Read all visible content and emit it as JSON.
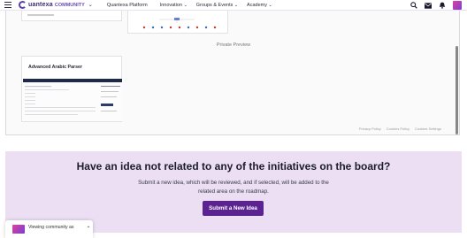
{
  "header": {
    "logo_text": "uantexa",
    "logo_sub": "COMMUNITY",
    "nav": [
      {
        "label": "Quantexa Platform",
        "has_menu": false
      },
      {
        "label": "Innovation",
        "has_menu": true
      },
      {
        "label": "Groups & Events",
        "has_menu": true
      },
      {
        "label": "Academy",
        "has_menu": true
      }
    ],
    "icons": [
      "search-icon",
      "mail-icon",
      "bell-icon",
      "avatar"
    ]
  },
  "board": {
    "section_label": "Private Preview",
    "card": {
      "title": "Advanced Arabic Parser"
    },
    "footer_links": [
      "Privacy Policy",
      "Cookies Policy",
      "Cookies Settings"
    ]
  },
  "idea": {
    "heading": "Have an idea not related to any of the initiatives on the board?",
    "body_line1": "Submit a new idea, which will be reviewed, and if selected, will be added to the",
    "body_line2": "related area on the roadmap.",
    "button": "Submit a New Idea"
  },
  "viewing": {
    "label": "Viewing community as"
  },
  "colors": {
    "accent": "#5b2391",
    "banner": "#ecdff4",
    "brand": "#5a3fa8"
  }
}
